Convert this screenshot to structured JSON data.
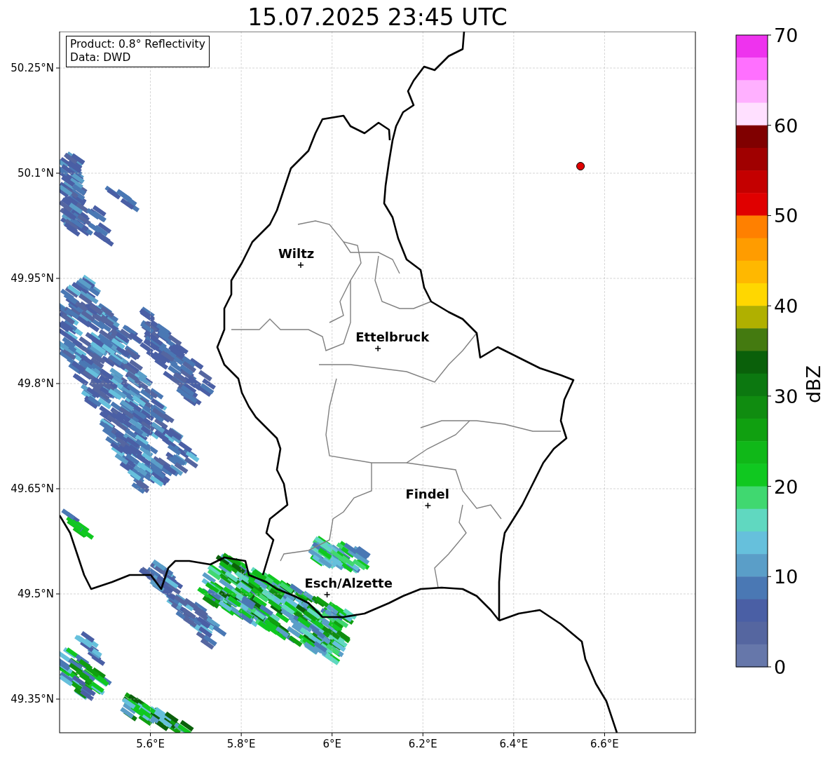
{
  "title": "15.07.2025 23:45 UTC",
  "info_box": {
    "lines": [
      "Product: 0.8° Reflectivity",
      "Data: DWD"
    ]
  },
  "map": {
    "y_tick_labels": [
      "50.25°N",
      "50.1°N",
      "49.95°N",
      "49.8°N",
      "49.65°N",
      "49.5°N",
      "49.35°N"
    ],
    "x_tick_labels": [
      "5.6°E",
      "5.8°E",
      "6°E",
      "6.2°E",
      "6.4°E",
      "6.6°E"
    ],
    "cities": [
      {
        "name": "Wiltz"
      },
      {
        "name": "Ettelbruck"
      },
      {
        "name": "Findel"
      },
      {
        "name": "Esch/Alzette"
      }
    ]
  },
  "colorbar": {
    "label": "dBZ",
    "ticks": [
      "70",
      "60",
      "50",
      "40",
      "30",
      "20",
      "10",
      "0"
    ],
    "bins": [
      {
        "color": "#ee33ee"
      },
      {
        "color": "#ff70ff"
      },
      {
        "color": "#ffb0ff"
      },
      {
        "color": "#ffe0ff"
      },
      {
        "color": "#800000"
      },
      {
        "color": "#a00000"
      },
      {
        "color": "#c40000"
      },
      {
        "color": "#e00000"
      },
      {
        "color": "#ff8000"
      },
      {
        "color": "#ff9c00"
      },
      {
        "color": "#ffb800"
      },
      {
        "color": "#ffd700"
      },
      {
        "color": "#b0b000"
      },
      {
        "color": "#447a10"
      },
      {
        "color": "#0a600a"
      },
      {
        "color": "#0c7810"
      },
      {
        "color": "#108c10"
      },
      {
        "color": "#10a010"
      },
      {
        "color": "#10b818"
      },
      {
        "color": "#10c820"
      },
      {
        "color": "#40d870"
      },
      {
        "color": "#60d8c0"
      },
      {
        "color": "#66c0dc"
      },
      {
        "color": "#5a9ec8"
      },
      {
        "color": "#4a78b4"
      },
      {
        "color": "#4a5fa5"
      },
      {
        "color": "#5566a0"
      },
      {
        "color": "#6677aa"
      }
    ]
  }
}
